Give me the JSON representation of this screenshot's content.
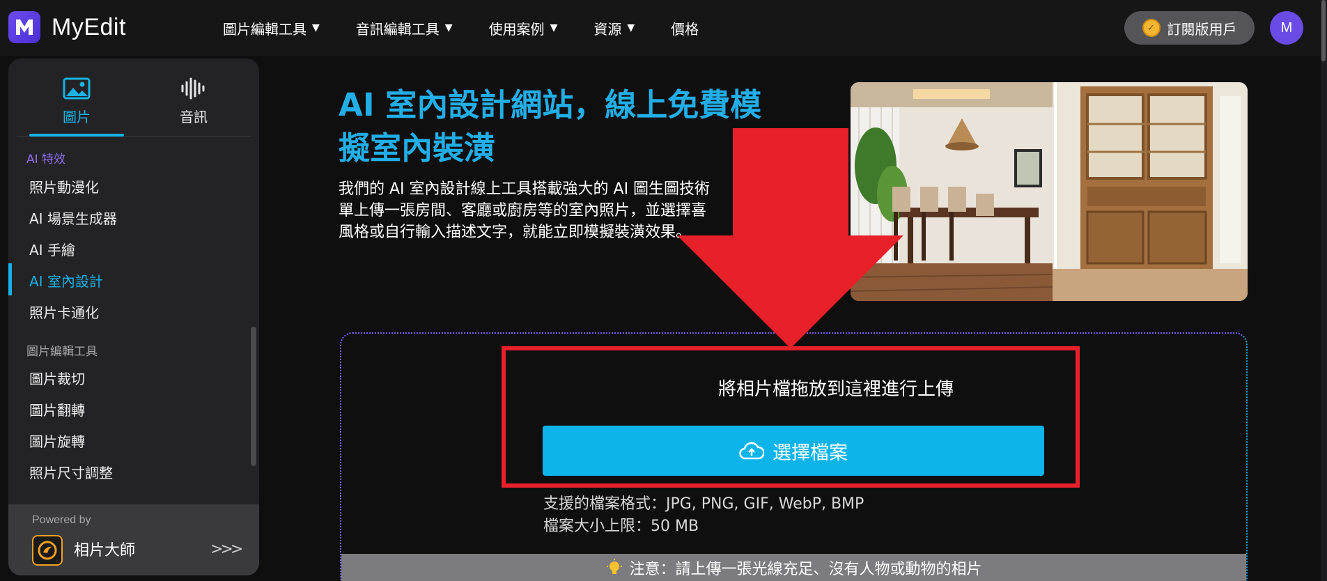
{
  "app": {
    "name": "MyEdit",
    "logo_letter": "M"
  },
  "nav": {
    "items": [
      {
        "label": "圖片編輯工具",
        "has_dropdown": true
      },
      {
        "label": "音訊編輯工具",
        "has_dropdown": true
      },
      {
        "label": "使用案例",
        "has_dropdown": true
      },
      {
        "label": "資源",
        "has_dropdown": true
      },
      {
        "label": "價格",
        "has_dropdown": false
      }
    ],
    "subscribe_label": "訂閱版用戶",
    "avatar_letter": "M"
  },
  "sidebar": {
    "tabs": [
      {
        "label": "圖片",
        "icon": "image-icon",
        "active": true
      },
      {
        "label": "音訊",
        "icon": "waveform-icon",
        "active": false
      }
    ],
    "sections": [
      {
        "title": "AI 特效",
        "items": [
          "照片動漫化",
          "AI 場景生成器",
          "AI 手繪",
          "AI 室內設計",
          "照片卡通化"
        ]
      },
      {
        "title": "圖片編輯工具",
        "items": [
          "圖片裁切",
          "圖片翻轉",
          "圖片旋轉",
          "照片尺寸調整"
        ]
      }
    ],
    "active_item": "AI 室內設計",
    "footer": {
      "powered_by": "Powered by",
      "product": "相片大師"
    }
  },
  "hero": {
    "title_line1": "AI 室內設計網站，線上免費模",
    "title_line2": "擬室內裝潢",
    "desc_line1": "我們的 AI 室內設計線上工具搭載強大的 AI 圖生圖技術",
    "desc_line2": "單上傳一張房間、客廳或廚房等的室內照片，並選擇喜",
    "desc_line3": "風格或自行輸入描述文字，就能立即模擬裝潢效果。"
  },
  "upload": {
    "drop_text": "將相片檔拖放到這裡進行上傳",
    "button_label": "選擇檔案",
    "formats": "支援的檔案格式：JPG, PNG, GIF, WebP, BMP",
    "size_limit": "檔案大小上限：50 MB",
    "note": "注意：請上傳一張光線充足、沒有人物或動物的相片"
  },
  "colors": {
    "accent": "#0db4ea",
    "highlight": "#e8202a",
    "brand": "#6d4cf0"
  }
}
